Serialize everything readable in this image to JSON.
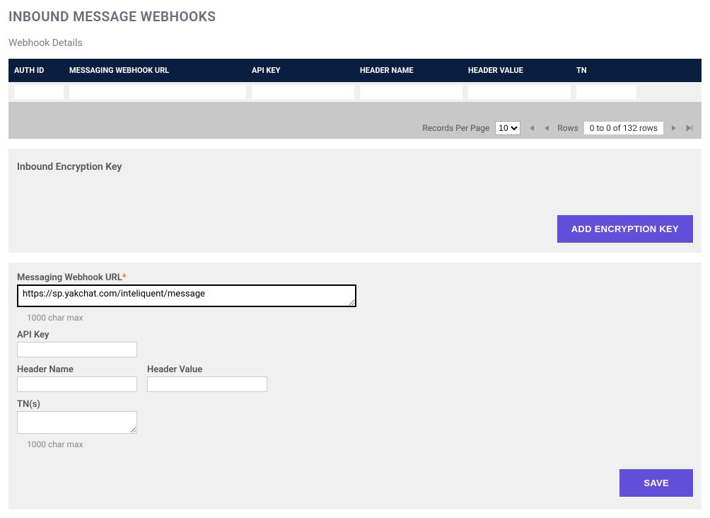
{
  "page_title": "INBOUND MESSAGE WEBHOOKS",
  "section_title": "Webhook Details",
  "table": {
    "headers": {
      "auth_id": "AUTH ID",
      "url": "MESSAGING WEBHOOK URL",
      "api_key": "API KEY",
      "header_name": "HEADER NAME",
      "header_value": "HEADER VALUE",
      "tn": "TN"
    }
  },
  "pager": {
    "records_label": "Records Per Page",
    "per_page": "10",
    "rows_label": "Rows",
    "rows_indicator": "0 to 0 of 132 rows"
  },
  "encryption": {
    "title": "Inbound Encryption Key",
    "add_btn": "ADD ENCRYPTION KEY"
  },
  "form": {
    "url_label": "Messaging Webhook URL",
    "url_value": "https://sp.yakchat.com/inteliquent/message",
    "url_hint": "1000 char max",
    "api_key_label": "API Key",
    "api_key_value": "",
    "header_name_label": "Header Name",
    "header_name_value": "",
    "header_value_label": "Header Value",
    "header_value_value": "",
    "tns_label": "TN(s)",
    "tns_value": "",
    "tns_hint": "1000 char max",
    "save_btn": "SAVE"
  }
}
